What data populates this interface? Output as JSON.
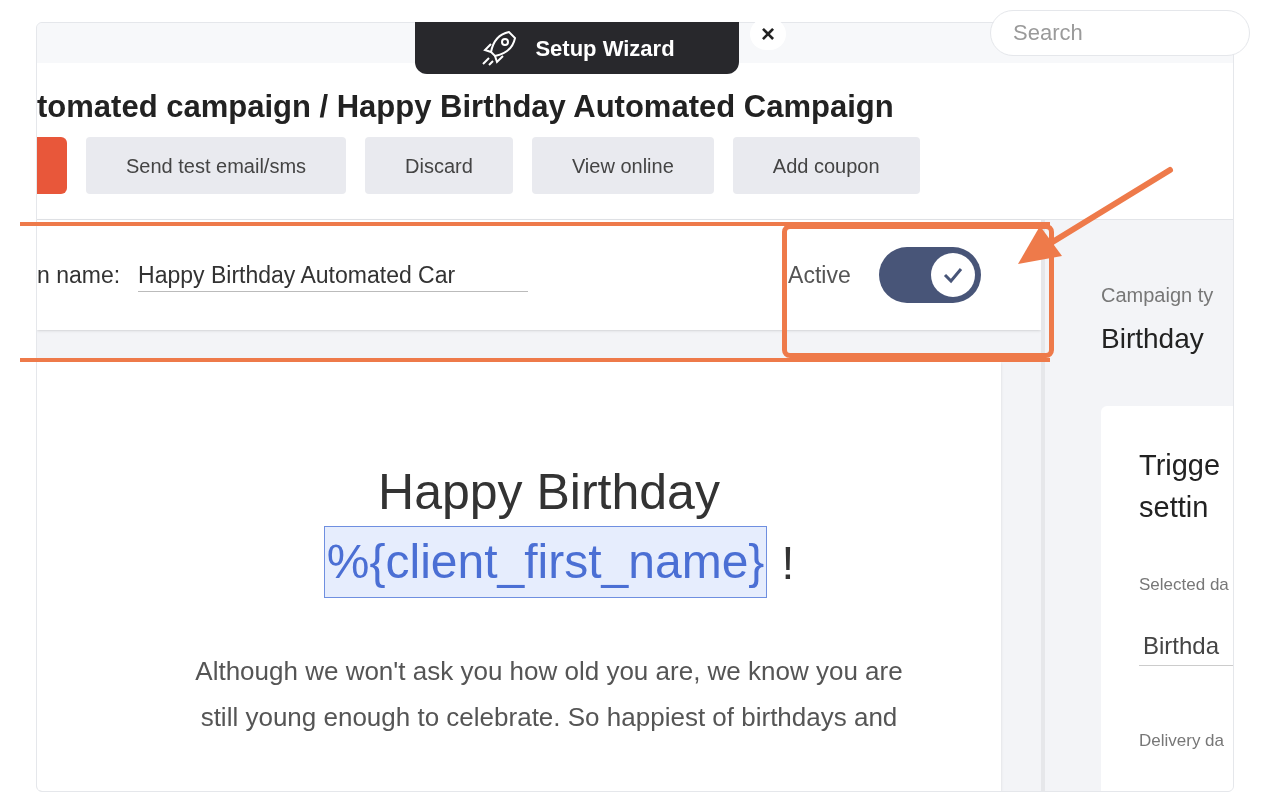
{
  "wizard": {
    "title": "Setup Wizard",
    "close": "×"
  },
  "search": {
    "placeholder": "Search"
  },
  "page_title": "tomated campaign / Happy Birthday Automated Campaign",
  "toolbar": [
    {
      "kind": "primary"
    },
    {
      "kind": "secondary",
      "label": "Send test email/sms"
    },
    {
      "kind": "secondary",
      "label": "Discard"
    },
    {
      "kind": "secondary",
      "label": "View online"
    },
    {
      "kind": "secondary",
      "label": "Add coupon"
    }
  ],
  "campaign_name": {
    "label": "n name:",
    "value": "Happy Birthday Automated Car"
  },
  "active": {
    "label": "Active",
    "on": true
  },
  "email": {
    "heading": "Happy Birthday",
    "token": "%{client_first_name}",
    "exclamation": "!",
    "body_lines": [
      "Although we won't ask you how old you are, we know you are",
      "still young enough to celebrate. So happiest of birthdays and"
    ]
  },
  "sidebar": {
    "type_label": "Campaign ty",
    "type_value": "Birthday",
    "card": {
      "title": "Trigge settin",
      "selected_label": "Selected da",
      "selected_value": "Birthda",
      "delivery_label": "Delivery da"
    }
  }
}
